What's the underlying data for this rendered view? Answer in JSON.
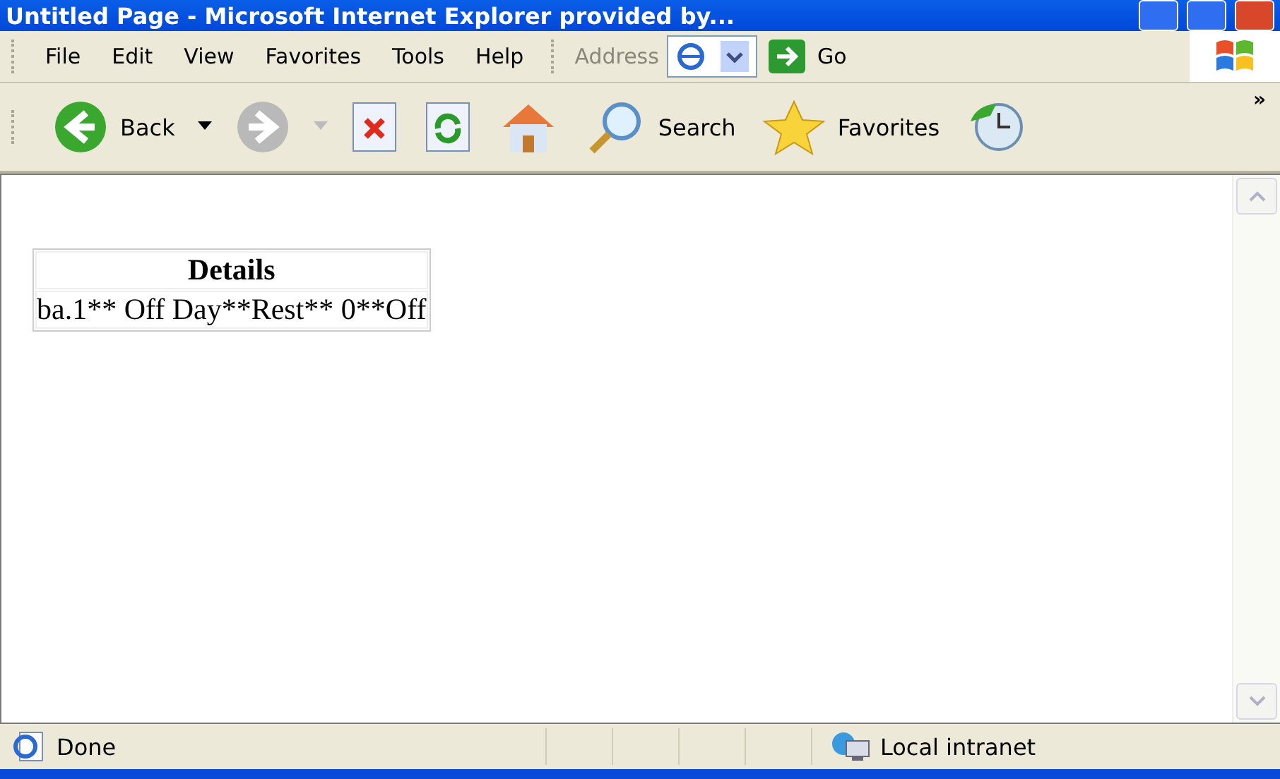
{
  "window": {
    "title": "Untitled Page - Microsoft Internet Explorer provided by..."
  },
  "menu": [
    "File",
    "Edit",
    "View",
    "Favorites",
    "Tools",
    "Help"
  ],
  "address": {
    "label": "Address",
    "go": "Go"
  },
  "toolbar": [
    {
      "kind": "back",
      "label": "Back"
    },
    {
      "kind": "forward"
    },
    {
      "kind": "stop"
    },
    {
      "kind": "refresh"
    },
    {
      "kind": "home"
    },
    {
      "kind": "search",
      "label": "Search"
    },
    {
      "kind": "favorites",
      "label": "Favorites"
    },
    {
      "kind": "history"
    }
  ],
  "toolbar_more": "»",
  "table": {
    "heading": "Details",
    "cell": "ba.1** Off Day**Rest** 0**Off"
  },
  "status_bar": {
    "text": "Done",
    "zone": "Local intranet"
  }
}
